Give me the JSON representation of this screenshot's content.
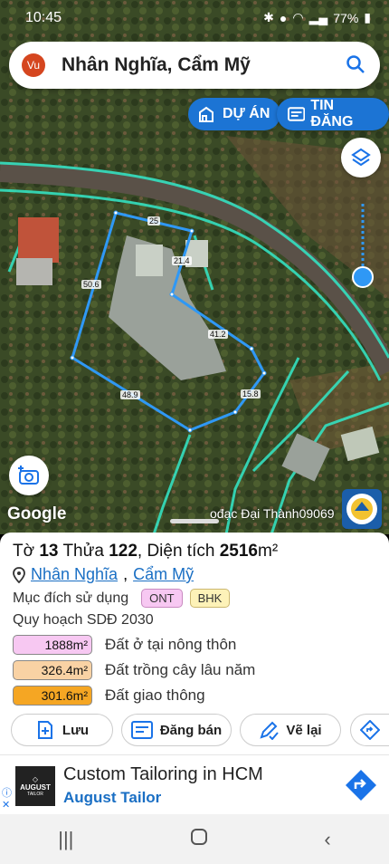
{
  "status": {
    "time": "10:45",
    "battery": "77%"
  },
  "search": {
    "avatar": "Vu",
    "text": "Nhân Nghĩa, Cẩm Mỹ"
  },
  "buttons": {
    "du_an": "DỰ ÁN",
    "tin_dang": "TIN ĐĂNG"
  },
  "map": {
    "google": "Google",
    "credit": "ođạc Đại Thành09069",
    "dimensions": [
      "25",
      "21.4",
      "50.6",
      "41.2",
      "48.9",
      "15.8"
    ]
  },
  "parcel": {
    "to_label": "Tờ",
    "to_value": "13",
    "thua_label": "Thửa",
    "thua_value": "122",
    "dientich_label": "Diện tích",
    "dientich_value": "2516",
    "unit": "m²",
    "location_1": "Nhân Nghĩa",
    "location_sep": ",",
    "location_2": "Cẩm Mỹ",
    "purpose_label": "Mục đích sử dụng",
    "purpose_tags": [
      "ONT",
      "BHK"
    ],
    "plan_label": "Quy hoạch SDĐ 2030",
    "areas": [
      {
        "value": "1888m²",
        "label": "Đất ở tại nông thôn",
        "color": "#f7c8f2"
      },
      {
        "value": "326.4m²",
        "label": "Đất trồng cây lâu năm",
        "color": "#f9d2a4"
      },
      {
        "value": "301.6m²",
        "label": "Đất giao thông",
        "color": "#f5a623"
      }
    ]
  },
  "actions": {
    "save": "Lưu",
    "sell": "Đăng bán",
    "redraw": "Vẽ lại"
  },
  "ad": {
    "brand": "AUGUST",
    "brand_sub": "TAILOR",
    "title": "Custom Tailoring in HCM",
    "subtitle": "August Tailor"
  }
}
